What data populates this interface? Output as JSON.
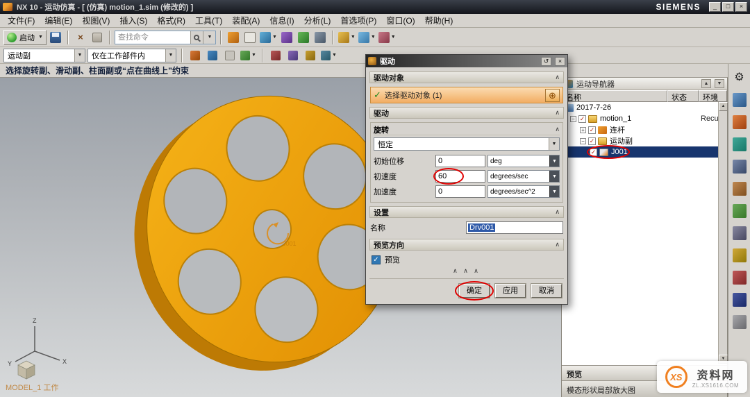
{
  "titlebar": {
    "app_title": "NX 10 - 运动仿真 - [ (仿真) motion_1.sim (修改的) ]",
    "brand": "SIEMENS"
  },
  "menu": {
    "items": [
      "文件(F)",
      "编辑(E)",
      "视图(V)",
      "插入(S)",
      "格式(R)",
      "工具(T)",
      "装配(A)",
      "信息(I)",
      "分析(L)",
      "首选项(P)",
      "窗口(O)",
      "帮助(H)"
    ]
  },
  "toolbar1": {
    "start_label": "启动",
    "search_placeholder": "查找命令"
  },
  "toolbar2": {
    "joint_filter": "运动副",
    "scope_filter": "仅在工作部件内"
  },
  "prompt": {
    "text": "选择旋转副、滑动副、柱面副或“点在曲线上”约束"
  },
  "viewport": {
    "part_label": "MODEL_1 工作",
    "joint_marker": "J001",
    "axes": {
      "x": "X",
      "y": "Y",
      "z": "Z"
    }
  },
  "dialog": {
    "title": "驱动",
    "drive_object_header": "驱动对象",
    "select_object": "选择驱动对象 (1)",
    "drive_header": "驱动",
    "rotation_header": "旋转",
    "profile": "恒定",
    "fields": [
      {
        "label": "初始位移",
        "value": "0",
        "unit": "deg"
      },
      {
        "label": "初速度",
        "value": "60",
        "unit": "degrees/sec"
      },
      {
        "label": "加速度",
        "value": "0",
        "unit": "degrees/sec^2"
      }
    ],
    "settings_header": "设置",
    "name_label": "名称",
    "name_value": "Drv001",
    "preview_header": "预览方向",
    "preview_label": "预览",
    "ok": "确定",
    "apply": "应用",
    "cancel": "取消"
  },
  "navigator": {
    "title": "运动导航器",
    "columns": [
      "名称",
      "状态",
      "环境"
    ],
    "rows": [
      {
        "label": "2017-7-26",
        "env": ""
      },
      {
        "label": "motion_1",
        "env": "Recurd"
      },
      {
        "label": "连杆",
        "env": ""
      },
      {
        "label": "运动副",
        "env": ""
      },
      {
        "label": "J001",
        "env": ""
      }
    ],
    "preview_bar": "预览",
    "detail_bar": "模态形状局部放大图"
  },
  "watermark": {
    "logo": "XS",
    "name": "资料网",
    "url": "ZL.XS1616.COM"
  },
  "icons": {
    "dropdown": "▼",
    "up": "▲",
    "check": "✓",
    "close": "×",
    "minimize": "_",
    "maximize": "□",
    "restore": "↺",
    "collapse": "∧",
    "collapse_triple": "∧ ∧ ∧",
    "minus": "−",
    "plus": "+",
    "target": "⊕",
    "gear": "⚙"
  },
  "colors": {
    "accent_orange": "#f0a30a",
    "selection_blue": "#17356e",
    "annotation_red": "#e00000"
  }
}
